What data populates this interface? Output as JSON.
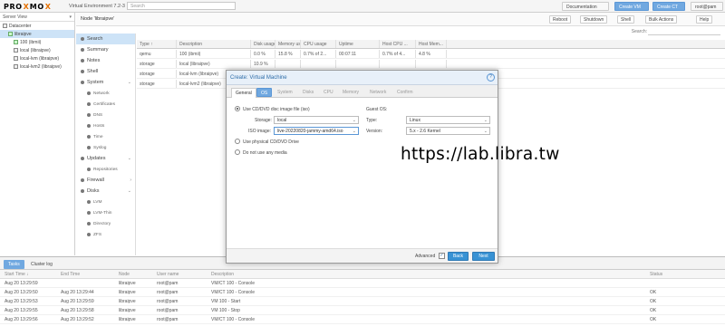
{
  "topbar": {
    "logo_a": "PRO",
    "logo_x": "X",
    "logo_b": "MO",
    "logo_x2": "X",
    "version": "Virtual Environment 7.2-3",
    "search_placeholder": "Search",
    "docs": "Documentation",
    "create_vm": "Create VM",
    "create_ct": "Create CT",
    "user": "root@pam"
  },
  "tree": {
    "view": "Server View",
    "items": [
      "Datacenter",
      "libraipve",
      "100 (ibmii)",
      "local (libraipve)",
      "local-lvm (libraipve)",
      "local-lvm2 (libraipve)"
    ]
  },
  "nodehead": {
    "title": "Node 'libraipve'",
    "reboot": "Reboot",
    "shutdown": "Shutdown",
    "shell": "Shell",
    "bulk": "Bulk Actions",
    "help": "Help"
  },
  "nav": {
    "items": [
      "Search",
      "Summary",
      "Notes",
      "Shell",
      "System",
      "Network",
      "Certificates",
      "DNS",
      "Hosts",
      "Time",
      "Syslog",
      "Updates",
      "Repositories",
      "Firewall",
      "Disks",
      "LVM",
      "LVM-Thin",
      "Directory",
      "ZFS"
    ]
  },
  "grid": {
    "search_label": "Search:",
    "headers": [
      "Type ↑",
      "Description",
      "Disk usage ...",
      "Memory us...",
      "CPU usage",
      "Uptime",
      "Host CPU ...",
      "Host Mem..."
    ],
    "rows": [
      [
        "qemu",
        "100 (ibmii)",
        "0.0 %",
        "15.8 %",
        "0.7% of 2...",
        "00:07:11",
        "0.7% of 4...",
        "4.8 %"
      ],
      [
        "storage",
        "local (libraipve)",
        "10.9 %",
        "",
        "",
        "",
        "",
        ""
      ],
      [
        "storage",
        "local-lvm (libraipve)",
        "",
        "",
        "",
        "",
        "",
        ""
      ],
      [
        "storage",
        "local-lvm2 (libraipve)",
        "",
        "",
        "",
        "",
        "",
        ""
      ]
    ]
  },
  "tasks": {
    "tab_tasks": "Tasks",
    "tab_cluster": "Cluster log",
    "headers": [
      "Start Time ↓",
      "End Time",
      "Node",
      "User name",
      "Description",
      "Status"
    ],
    "rows": [
      [
        "Aug 20 13:29:59",
        "",
        "libraipve",
        "root@pam",
        "VM/CT 100 - Console",
        ""
      ],
      [
        "Aug 20 13:29:50",
        "Aug 20 13:29:44",
        "libraipve",
        "root@pam",
        "VM/CT 100 - Console",
        "OK"
      ],
      [
        "Aug 20 13:29:53",
        "Aug 20 13:29:59",
        "libraipve",
        "root@pam",
        "VM 100 - Start",
        "OK"
      ],
      [
        "Aug 20 13:29:55",
        "Aug 20 13:29:58",
        "libraipve",
        "root@pam",
        "VM 100 - Stop",
        "OK"
      ],
      [
        "Aug 20 13:29:56",
        "Aug 20 13:29:52",
        "libraipve",
        "root@pam",
        "VM/CT 100 - Console",
        "OK"
      ]
    ]
  },
  "modal": {
    "title": "Create: Virtual Machine",
    "tabs": [
      "General",
      "OS",
      "System",
      "Disks",
      "CPU",
      "Memory",
      "Network",
      "Confirm"
    ],
    "use_cd": "Use CD/DVD disc image file (iso)",
    "storage_label": "Storage:",
    "storage_value": "local",
    "iso_label": "ISO image:",
    "iso_value": "live-20220820-jammy-amd64.iso",
    "use_physical": "Use physical CD/DVD Drive",
    "no_media": "Do not use any media",
    "guest_os": "Guest OS:",
    "type_label": "Type:",
    "type_value": "Linux",
    "version_label": "Version:",
    "version_value": "5.x - 2.6 Kernel",
    "advanced": "Advanced",
    "back": "Back",
    "next": "Next"
  },
  "watermark": "https://lab.libra.tw"
}
